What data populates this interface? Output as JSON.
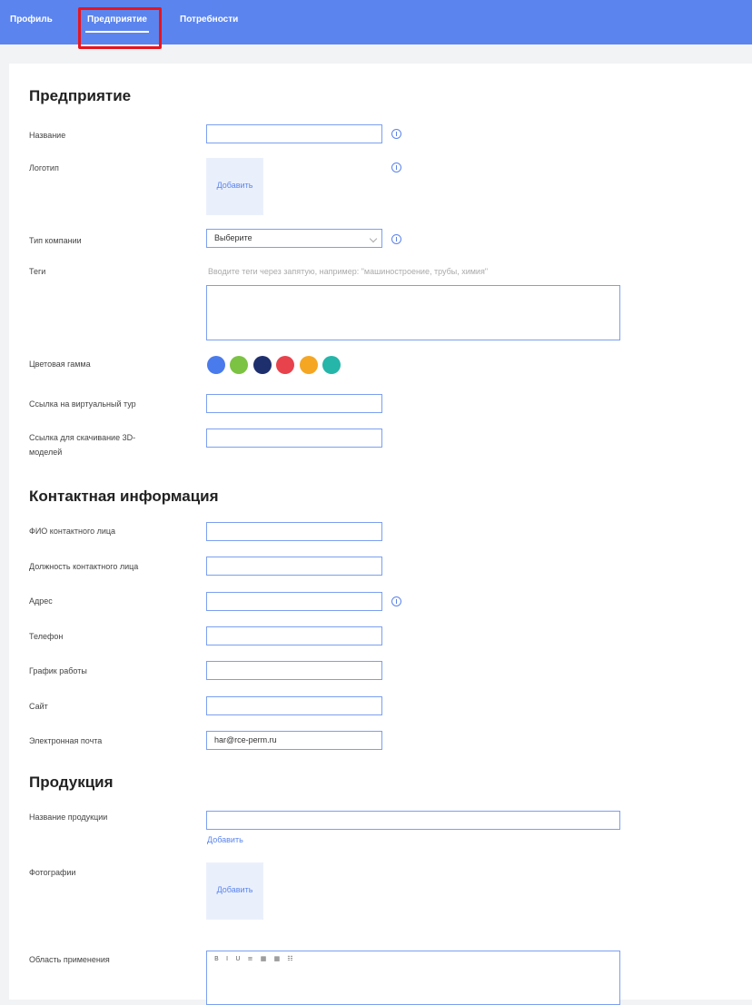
{
  "nav": {
    "tabs": [
      {
        "label": "Профиль"
      },
      {
        "label": "Предприятие"
      },
      {
        "label": "Потребности"
      }
    ],
    "active_tab": "Предприятие",
    "highlight_color": "#e8141e",
    "bar_color": "#5b84ee"
  },
  "enterprise": {
    "title": "Предприятие",
    "name_label": "Название",
    "name_value": "",
    "logo_label": "Логотип",
    "logo_button": "Добавить",
    "company_type_label": "Тип компании",
    "company_type_value": "Выберите",
    "tags_label": "Теги",
    "tags_hint": "Вводите теги через запятую, например: \"машиностроение, трубы, химия\"",
    "tags_value": "",
    "color_label": "Цветовая гамма",
    "colors": [
      "#4a7bec",
      "#7cc243",
      "#1e2f6e",
      "#e8424c",
      "#f5a623",
      "#26b5a9"
    ],
    "tour_label": "Ссылка на виртуальный тур",
    "tour_value": "",
    "models_label": "Ссылка для скачивание 3D-моделей",
    "models_value": ""
  },
  "contact": {
    "title": "Контактная информация",
    "fio_label": "ФИО контактного лица",
    "fio_value": "",
    "position_label": "Должность контактного лица",
    "position_value": "",
    "address_label": "Адрес",
    "address_value": "",
    "phone_label": "Телефон",
    "phone_value": "",
    "schedule_label": "График работы",
    "schedule_value": "",
    "site_label": "Сайт",
    "site_value": "",
    "email_label": "Электронная почта",
    "email_value": "har@rce-perm.ru"
  },
  "products": {
    "title": "Продукция",
    "product_name_label": "Название продукции",
    "product_name_value": "",
    "add_link": "Добавить",
    "photos_label": "Фотографии",
    "photos_button": "Добавить",
    "scope_label": "Область применения",
    "editor_toolbar": "B I U ≡ ▦ ▦ ☷"
  }
}
